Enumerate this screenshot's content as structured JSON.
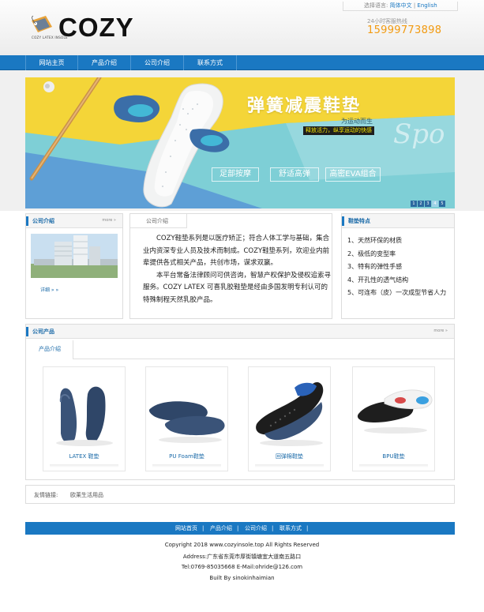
{
  "header": {
    "lang_label": "选择语言:",
    "lang_cn": "简体中文",
    "lang_sep": "|",
    "lang_en": "English",
    "hotline_label": "24小时客服热线",
    "phone": "15999773898",
    "logo_text": "COZY",
    "logo_sub": "COZY LATEX INSOLE"
  },
  "nav": {
    "items": [
      "网站主页",
      "产品介绍",
      "公司介绍",
      "联系方式"
    ]
  },
  "banner": {
    "title": "弹簧减震鞋垫",
    "subtitle": "为运动而生",
    "tagline": "释放活力，纵享运动的快感",
    "buttons": [
      "足部按摩",
      "舒适高弹",
      "高密EVA组合"
    ],
    "deco_text": "Spo",
    "dots": [
      "1",
      "2",
      "3",
      "4",
      "5"
    ]
  },
  "about_left": {
    "title": "公司介绍",
    "more": "more »",
    "detail": "详细 » »"
  },
  "about_middle": {
    "tab": "公司介绍",
    "p1": "COZY鞋垫系列是以医疗矫正；符合人体工学与基础，集合业内资深专业人员及技术而制成。COZY鞋垫系列，欢迎业内前辈提供各式相关产品，共创市场，谋求双赢。",
    "p2": "本平台常备法律顾问可供咨询，智慧产权保护及侵权追索寻服务。COZY LATEX 可喜乳胶鞋垫是经由多国发明专利认可的特殊制程天然乳胶产品。"
  },
  "features": {
    "title": "鞋垫特点",
    "items": [
      "1、天然环保的材质",
      "2、极低的变型率",
      "3、特有的弹性手感",
      "4、开孔性的透气结构",
      "5、可连布（皮）一次成型节省人力"
    ]
  },
  "products": {
    "title": "公司产品",
    "more": "more »",
    "tab": "产品介绍",
    "items": [
      "LATEX 鞋垫",
      "PU Foam鞋垫",
      "回弹棉鞋垫",
      "BPU鞋垫"
    ]
  },
  "links": {
    "label": "友情链接:",
    "items": [
      "欧莱生活用品"
    ]
  },
  "footer": {
    "nav": [
      "网站首页",
      "|",
      "产品介绍",
      "|",
      "公司介绍",
      "|",
      "联系方式",
      "|"
    ],
    "copyright": "Copyright 2018 www.cozyinsole.top All Rights Reserved",
    "address": "Address:广东省东莞市厚街镇塘宜大道南五路口",
    "contact": "Tel:0769-85035668 E-Mail:ohride@126.com",
    "built": "Built By sinokinhaimian"
  },
  "colors": {
    "brand_blue": "#1a78c2",
    "phone_orange": "#f29a10",
    "banner_yellow": "#f4d538",
    "banner_teal": "#7ecfd6"
  }
}
